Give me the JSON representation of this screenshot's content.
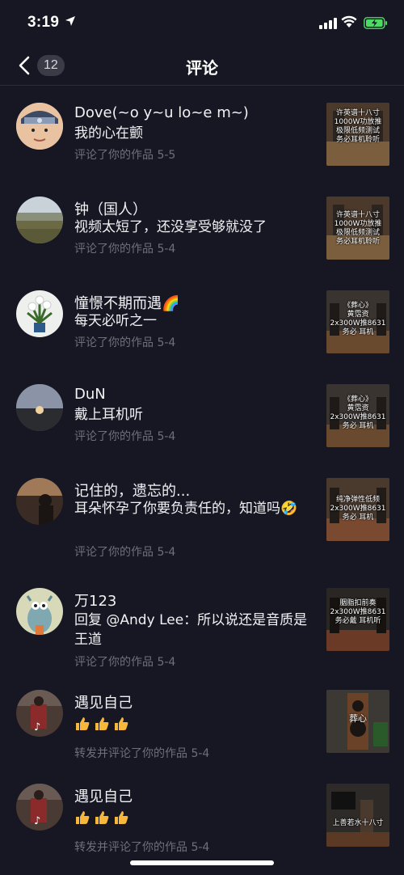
{
  "status": {
    "time": "3:19"
  },
  "nav": {
    "count": "12",
    "title": "评论"
  },
  "items": [
    {
      "username": "Dove(~o y~u lo~e m~)",
      "comment": "我的心在颤",
      "meta": "评论了你的作品  5-5",
      "thumb_text": "许英谱十八寸\n1000W功放推\n极限低频测试\n务必耳机聆听"
    },
    {
      "username": "钟（国人）",
      "comment": "视频太短了，还没享受够就没了",
      "meta": "评论了你的作品  5-4",
      "thumb_text": "许英谱十八寸\n1000W功放推\n极限低频测试\n务必耳机聆听"
    },
    {
      "username": "憧憬不期而遇🌈",
      "comment": "每天必听之一",
      "meta": "评论了你的作品  5-4",
      "thumb_text": "《葬心》\n黄霑资\n2x300W推8631\n务必  耳机"
    },
    {
      "username": "DuN",
      "comment": "戴上耳机听",
      "meta": "评论了你的作品  5-4",
      "thumb_text": "《葬心》\n黄霑资\n2x300W推8631\n务必  耳机"
    },
    {
      "username": "记住的，遗忘的...",
      "comment": "耳朵怀孕了你要负责任的，知道吗🤣",
      "meta": "评论了你的作品  5-4",
      "thumb_text": "纯净弹性低频\n2x300W推8631\n务必  耳机"
    },
    {
      "username": "万123",
      "comment": "回复 @Andy Lee：所以说还是音质是王道",
      "meta": "评论了你的作品  5-4",
      "thumb_text": "胭脂扣前奏\n2x300W推8631\n务必戴  耳机听"
    },
    {
      "username": "遇见自己",
      "comment": "",
      "meta": "转发并评论了你的作品  5-4",
      "thumb_text": "葬心"
    },
    {
      "username": "遇见自己",
      "comment": "",
      "meta": "转发并评论了你的作品  5-4",
      "thumb_text": "上善若水十八寸"
    }
  ],
  "icons": {
    "back": "chevron-left-icon",
    "location": "location-arrow-icon",
    "signal": "signal-icon",
    "wifi": "wifi-icon",
    "battery": "battery-charging-icon",
    "thumbs_up": "thumbs-up-emoji-icon"
  },
  "colors": {
    "background": "#161723",
    "meta_text": "#6e6f7a",
    "badge": "#3a3b47",
    "battery": "#4cd964"
  }
}
